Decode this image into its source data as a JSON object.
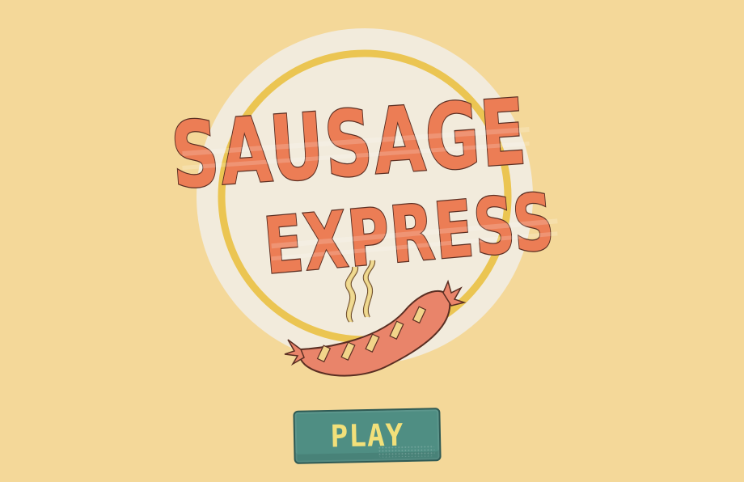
{
  "game": {
    "title_line1": "SAUSAGE",
    "title_line2": "EXPRESS",
    "play_label": "PLAY"
  },
  "icons": [
    "sausage-icon",
    "steam-icon"
  ],
  "colors": {
    "background": "#f4d899",
    "title_fill": "#ec7d55",
    "title_outline": "#5a2e22",
    "badge_circle": "#f2ebdc",
    "badge_ring": "#ebc552",
    "button": "#4f8e83",
    "button_text": "#f2e07a"
  }
}
